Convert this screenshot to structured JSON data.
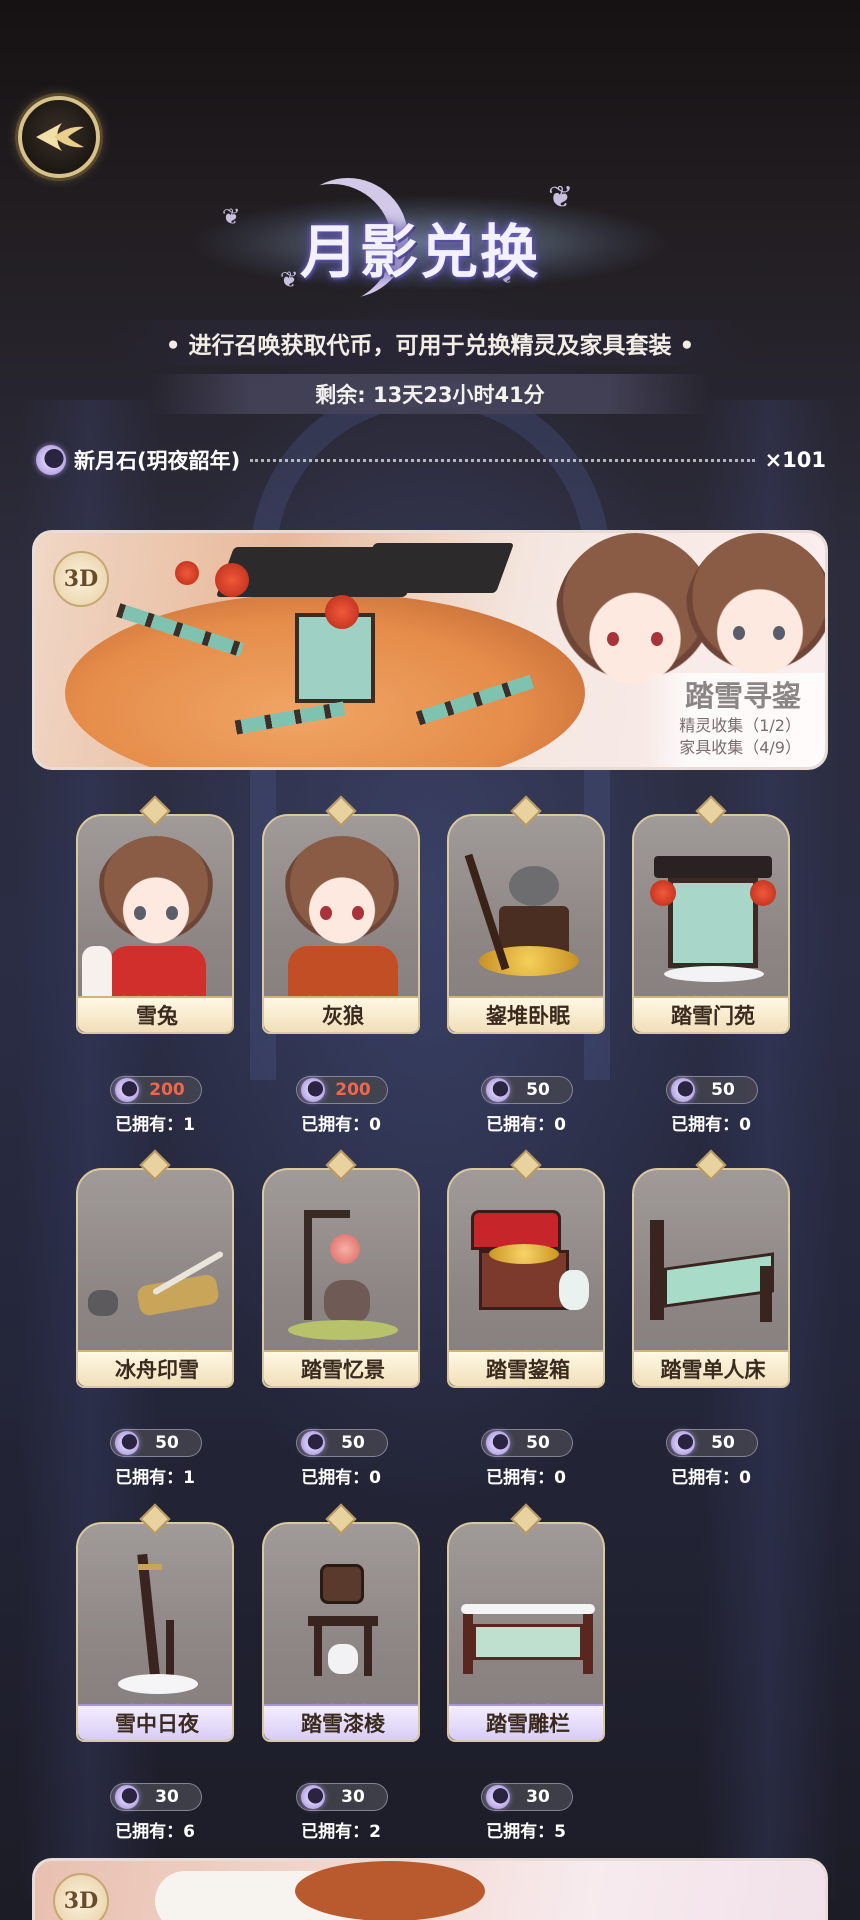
{
  "header": {
    "title": "月影兑换",
    "subtitle": "• 进行召唤获取代币，可用于兑换精灵及家具套装 •",
    "timer": "剩余: 13天23小时41分"
  },
  "currency": {
    "icon": "moonstone-icon",
    "name": "新月石(玥夜韶年)",
    "count": "×101"
  },
  "banner": {
    "badge": "3D",
    "title": "踏雪寻鋆",
    "spirit_progress": "精灵收集（1/2）",
    "furniture_progress": "家具收集（4/9）"
  },
  "items": [
    {
      "name": "雪兔",
      "price": "200",
      "price_red": true,
      "owned": "已拥有：1",
      "stars": "★★★★★",
      "rarity": "gold"
    },
    {
      "name": "灰狼",
      "price": "200",
      "price_red": true,
      "owned": "已拥有：0",
      "stars": "★★★★★",
      "rarity": "gold"
    },
    {
      "name": "鋆堆卧眠",
      "price": "50",
      "price_red": false,
      "owned": "已拥有：0",
      "stars": "★★★★★",
      "rarity": "gold"
    },
    {
      "name": "踏雪门苑",
      "price": "50",
      "price_red": false,
      "owned": "已拥有：0",
      "stars": "★★★★★",
      "rarity": "gold"
    },
    {
      "name": "冰舟印雪",
      "price": "50",
      "price_red": false,
      "owned": "已拥有：1",
      "stars": "★★★★★",
      "rarity": "gold"
    },
    {
      "name": "踏雪忆景",
      "price": "50",
      "price_red": false,
      "owned": "已拥有：0",
      "stars": "★★★★★",
      "rarity": "gold"
    },
    {
      "name": "踏雪鋆箱",
      "price": "50",
      "price_red": false,
      "owned": "已拥有：0",
      "stars": "★★★★★",
      "rarity": "gold"
    },
    {
      "name": "踏雪单人床",
      "price": "50",
      "price_red": false,
      "owned": "已拥有：0",
      "stars": "★★★★★",
      "rarity": "gold"
    },
    {
      "name": "雪中日夜",
      "price": "30",
      "price_red": false,
      "owned": "已拥有：6",
      "stars": "★★★★",
      "rarity": "purple"
    },
    {
      "name": "踏雪漆棱",
      "price": "30",
      "price_red": false,
      "owned": "已拥有：2",
      "stars": "★★★★",
      "rarity": "purple"
    },
    {
      "name": "踏雪雕栏",
      "price": "30",
      "price_red": false,
      "owned": "已拥有：5",
      "stars": "★★★★",
      "rarity": "purple"
    }
  ],
  "bottom_banner": {
    "badge": "3D"
  },
  "colors": {
    "price_red": "#f2664a",
    "gold_trim": "#d9c8a0",
    "purple_plate": "#d8ccf5"
  }
}
